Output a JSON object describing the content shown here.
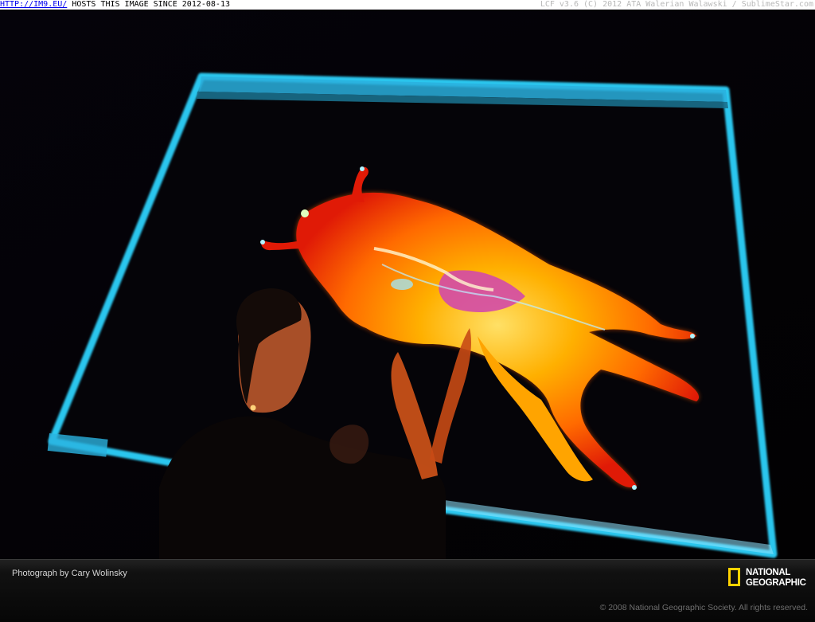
{
  "top_bar": {
    "link_text": "HTTP://IM9.EU/",
    "left_text": " HOSTS THIS IMAGE SINCE 2012-08-13",
    "right_text": "LCF v3.6 (C) 2012 ATA Walerian Walawski / SublimeStar.com"
  },
  "footer": {
    "credit": "Photograph by Cary Wolinsky",
    "logo_line1": "NATIONAL",
    "logo_line2": "GEOGRAPHIC",
    "copyright": "© 2008 National Geographic Society. All rights reserved."
  },
  "colors": {
    "screen_frame": "#29c6ee",
    "logo_yellow": "#ffd200",
    "scan_red": "#e01a06",
    "scan_orange": "#ff8a00",
    "scan_yellow": "#ffd23a"
  }
}
